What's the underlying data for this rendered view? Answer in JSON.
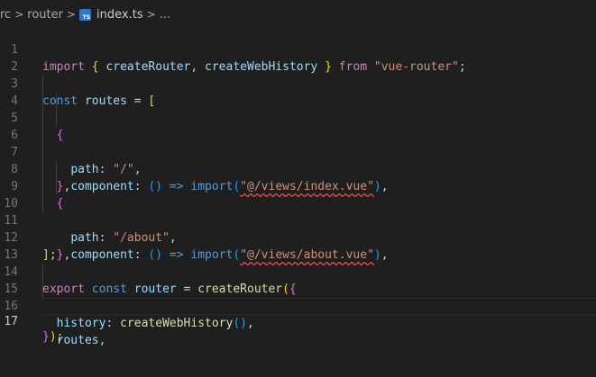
{
  "breadcrumb": {
    "parts": [
      "rc",
      "router",
      "index.ts",
      "..."
    ],
    "separator": ">"
  },
  "editor": {
    "active_line": 17,
    "lines": [
      {
        "n": "1",
        "tokens": [
          "import",
          " ",
          "{",
          " ",
          "createRouter",
          ", ",
          "createWebHistory",
          " ",
          "}",
          " ",
          "from",
          " ",
          "\"vue-router\"",
          ";"
        ]
      },
      {
        "n": "2",
        "tokens": []
      },
      {
        "n": "3",
        "tokens": [
          "const",
          " ",
          "routes",
          " = ",
          "["
        ]
      },
      {
        "n": "4",
        "tokens": [
          "  ",
          "{"
        ]
      },
      {
        "n": "5",
        "tokens": [
          "    ",
          "path",
          ": ",
          "\"/\"",
          ","
        ]
      },
      {
        "n": "6",
        "tokens": [
          "    ",
          "component",
          ": ",
          "()",
          " ",
          "=>",
          " ",
          "import",
          "(",
          "\"@/views/index.vue\"",
          ")",
          ","
        ]
      },
      {
        "n": "7",
        "tokens": [
          "  ",
          "}",
          ","
        ]
      },
      {
        "n": "8",
        "tokens": [
          "  ",
          "{"
        ]
      },
      {
        "n": "9",
        "tokens": [
          "    ",
          "path",
          ": ",
          "\"/about\"",
          ","
        ]
      },
      {
        "n": "10",
        "tokens": [
          "    ",
          "component",
          ": ",
          "()",
          " ",
          "=>",
          " ",
          "import",
          "(",
          "\"@/views/about.vue\"",
          ")",
          ","
        ]
      },
      {
        "n": "11",
        "tokens": [
          "  ",
          "}",
          ","
        ]
      },
      {
        "n": "12",
        "tokens": [
          "]",
          ";"
        ]
      },
      {
        "n": "13",
        "tokens": []
      },
      {
        "n": "14",
        "tokens": [
          "export",
          " ",
          "const",
          " ",
          "router",
          " = ",
          "createRouter",
          "(",
          "{"
        ]
      },
      {
        "n": "15",
        "tokens": [
          "  ",
          "history",
          ": ",
          "createWebHistory",
          "()",
          ","
        ]
      },
      {
        "n": "16",
        "tokens": [
          "  ",
          "routes",
          ","
        ]
      },
      {
        "n": "17",
        "tokens": [
          "}",
          ")",
          ";"
        ]
      }
    ]
  },
  "colors": {
    "background": "#1f1f1f",
    "keyword": "#569cd6",
    "control_keyword": "#c586c0",
    "variable": "#9cdcfe",
    "function": "#dcdcaa",
    "string": "#ce9178",
    "bracket_level1": "#ffd700",
    "bracket_level2": "#da70d6",
    "bracket_level3": "#179fff",
    "error_squiggle": "#f14c4c"
  },
  "icons": {
    "file": "typescript-file-icon",
    "separator": "chevron-right-icon"
  }
}
